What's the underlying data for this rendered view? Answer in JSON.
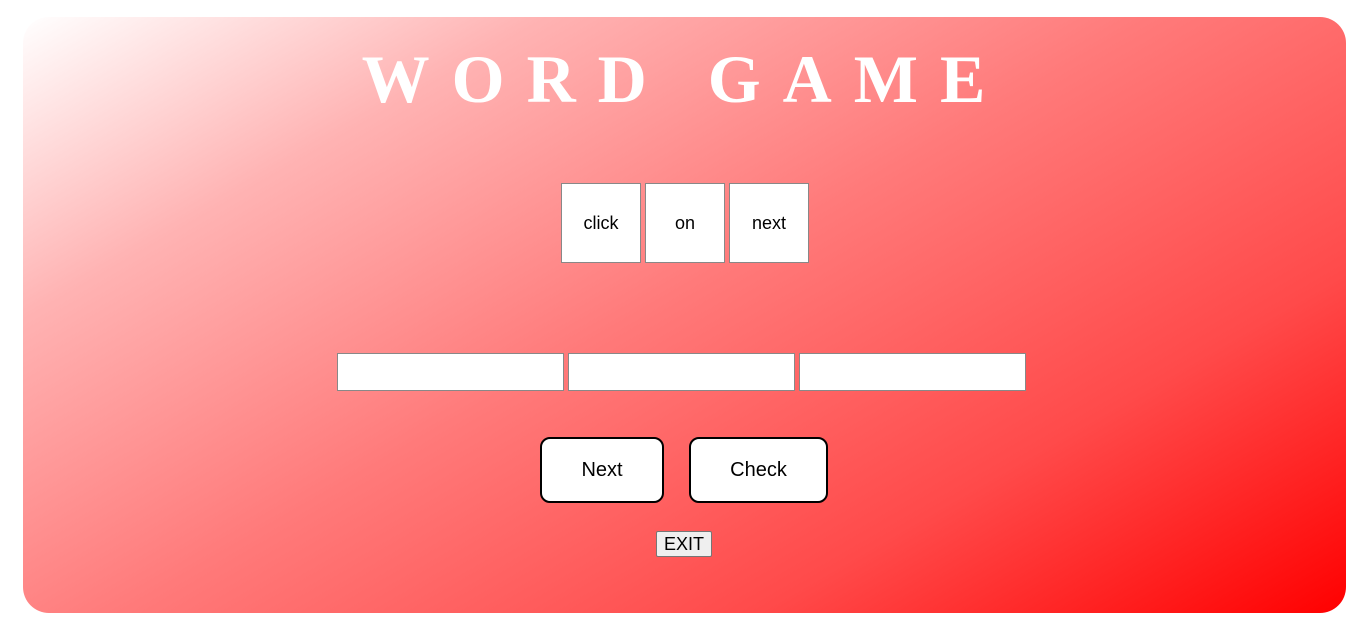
{
  "title": "WORD GAME",
  "tiles": [
    "click",
    "on",
    "next"
  ],
  "answers": [
    {
      "value": "",
      "placeholder": ""
    },
    {
      "value": "",
      "placeholder": ""
    },
    {
      "value": "",
      "placeholder": ""
    }
  ],
  "buttons": {
    "next_label": "Next",
    "check_label": "Check",
    "exit_label": "EXIT"
  },
  "colors": {
    "gradient_start": "#ffffff",
    "gradient_end": "#ff0000",
    "title": "#ffffff"
  }
}
